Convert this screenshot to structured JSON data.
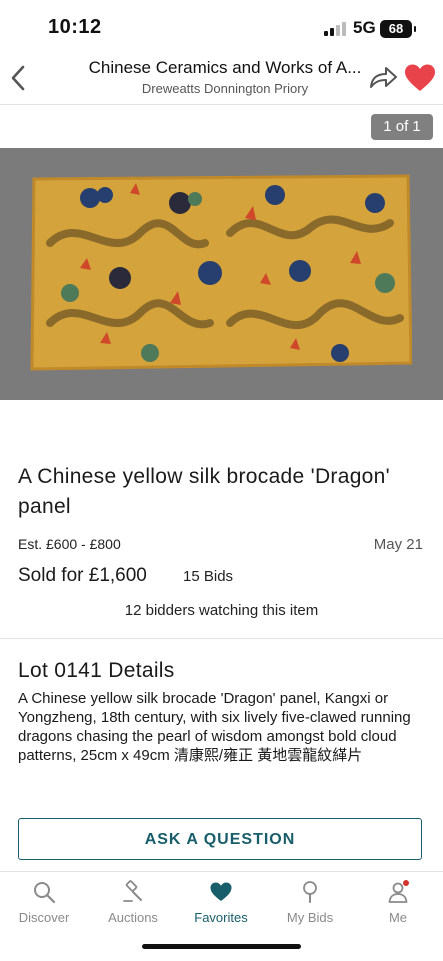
{
  "status_bar": {
    "time": "10:12",
    "network": "5G",
    "battery": "68"
  },
  "header": {
    "title": "Chinese Ceramics and Works of A...",
    "subtitle": "Dreweatts Donnington Priory"
  },
  "gallery": {
    "counter": "1 of 1"
  },
  "lot": {
    "title": "A Chinese yellow silk brocade 'Dragon' panel",
    "estimate": "Est. £600 - £800",
    "date": "May 21",
    "sold": "Sold for £1,600",
    "bids": "15 Bids",
    "watching": "12 bidders watching this item",
    "details_heading": "Lot 0141 Details",
    "description": "A Chinese yellow silk brocade 'Dragon' panel, Kangxi or Yongzheng, 18th century, with six lively five-clawed running dragons chasing the pearl of wisdom amongst bold cloud patterns, 25cm x 49cm 清康熙/雍正 黃地雲龍紋緙片"
  },
  "ask_button": "ASK A QUESTION",
  "tabs": [
    {
      "label": "Discover",
      "icon": "search-icon"
    },
    {
      "label": "Auctions",
      "icon": "gavel-icon"
    },
    {
      "label": "Favorites",
      "icon": "heart-icon"
    },
    {
      "label": "My Bids",
      "icon": "paddle-icon"
    },
    {
      "label": "Me",
      "icon": "person-icon"
    }
  ],
  "colors": {
    "accent": "#185d6a",
    "favorite": "#e8434b",
    "image_bg": "#7b7b7b"
  }
}
